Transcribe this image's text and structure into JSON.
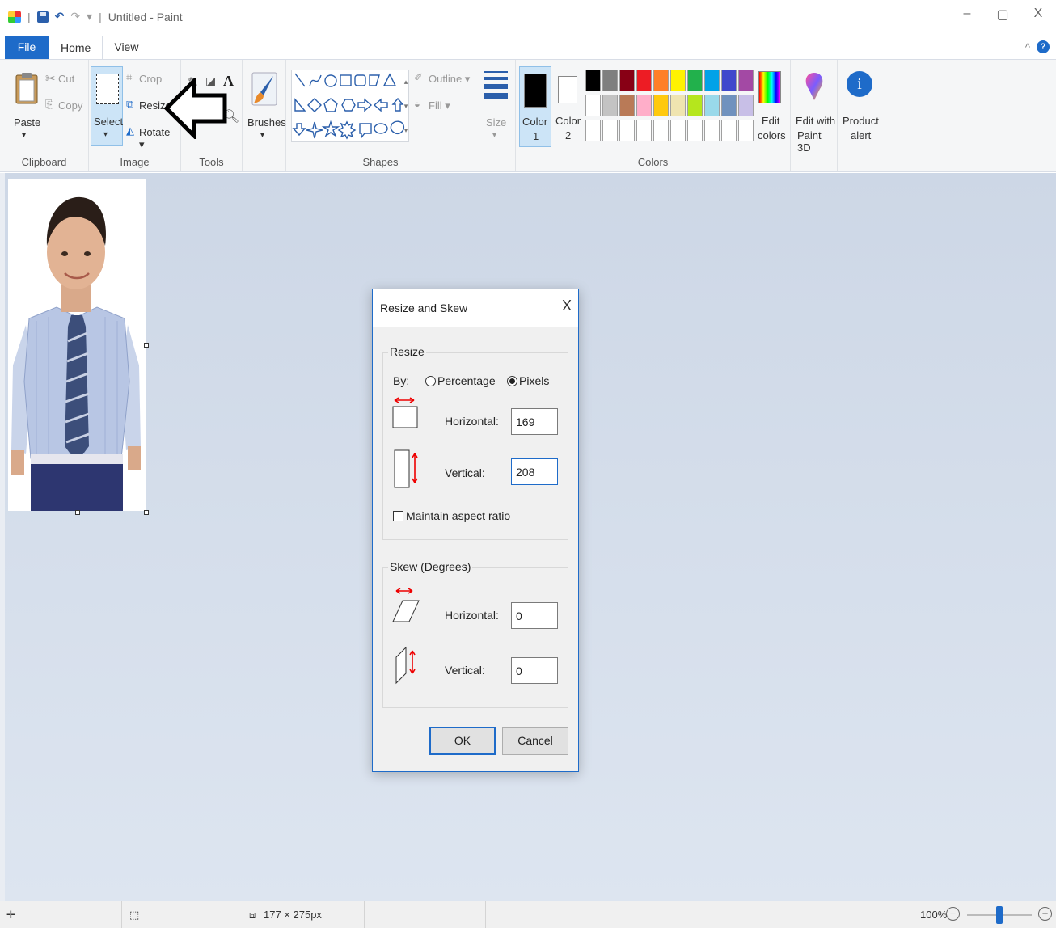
{
  "titlebar": {
    "title": "Untitled - Paint",
    "separator": "|",
    "qa_dropdown": "▾",
    "minimize": "–",
    "maximize": "▢",
    "close": "X"
  },
  "tabs": {
    "file": "File",
    "home": "Home",
    "view": "View",
    "collapse": "^",
    "help": "?"
  },
  "ribbon": {
    "clipboard": {
      "paste": "Paste",
      "cut": "Cut",
      "copy": "Copy",
      "label": "Clipboard"
    },
    "image": {
      "select": "Select",
      "crop": "Crop",
      "resize": "Resize",
      "rotate": "Rotate ▾",
      "label": "Image"
    },
    "tools": {
      "label": "Tools"
    },
    "brushes": {
      "label": "Brushes"
    },
    "shapes": {
      "outline": "Outline ▾",
      "fill": "Fill ▾",
      "label": "Shapes"
    },
    "size": {
      "label": "Size"
    },
    "colors": {
      "color1": "Color",
      "color1_num": "1",
      "color2": "Color",
      "color2_num": "2",
      "edit": "Edit",
      "edit2": "colors",
      "label": "Colors",
      "palette_row1": [
        "#000000",
        "#7f7f7f",
        "#880015",
        "#ed1c24",
        "#ff7f27",
        "#fff200",
        "#22b14c",
        "#00a2e8",
        "#3f48cc",
        "#a349a4"
      ],
      "palette_row2": [
        "#ffffff",
        "#c3c3c3",
        "#b97a57",
        "#ffaec9",
        "#ffc90e",
        "#efe4b0",
        "#b5e61d",
        "#99d9ea",
        "#7092be",
        "#c8bfe7"
      ]
    },
    "paint3d": {
      "line1": "Edit with",
      "line2": "Paint 3D"
    },
    "product": {
      "line1": "Product",
      "line2": "alert"
    }
  },
  "dialog": {
    "title": "Resize and Skew",
    "close": "X",
    "resize_legend": "Resize",
    "by": "By:",
    "percentage": "Percentage",
    "pixels": "Pixels",
    "horizontal_label": "Horizontal:",
    "horizontal_value": "169",
    "vertical_label": "Vertical:",
    "vertical_value": "208",
    "maintain": "Maintain aspect ratio",
    "skew_legend": "Skew (Degrees)",
    "skew_h_label": "Horizontal:",
    "skew_h_value": "0",
    "skew_v_label": "Vertical:",
    "skew_v_value": "0",
    "ok": "OK",
    "cancel": "Cancel"
  },
  "status": {
    "image_size": "177 × 275px",
    "zoom": "100%"
  }
}
